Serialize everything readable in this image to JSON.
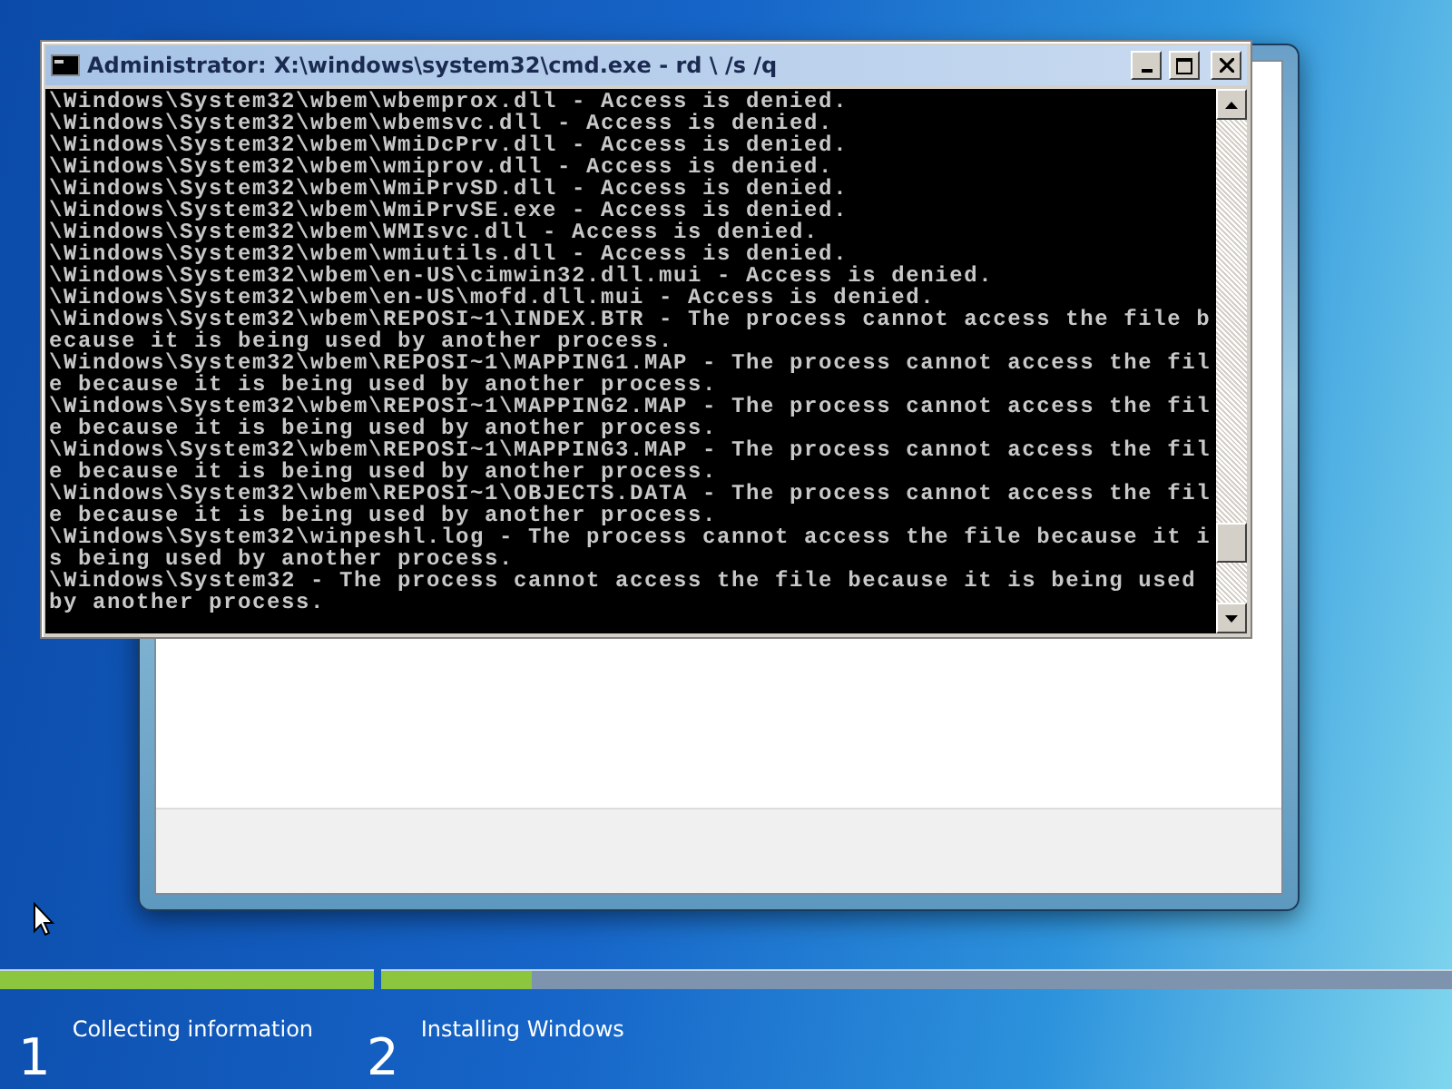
{
  "console_window": {
    "title": "Administrator: X:\\windows\\system32\\cmd.exe - rd \\ /s /q",
    "lines": [
      "\\Windows\\System32\\wbem\\wbemprox.dll - Access is denied.",
      "\\Windows\\System32\\wbem\\wbemsvc.dll - Access is denied.",
      "\\Windows\\System32\\wbem\\WmiDcPrv.dll - Access is denied.",
      "\\Windows\\System32\\wbem\\wmiprov.dll - Access is denied.",
      "\\Windows\\System32\\wbem\\WmiPrvSD.dll - Access is denied.",
      "\\Windows\\System32\\wbem\\WmiPrvSE.exe - Access is denied.",
      "\\Windows\\System32\\wbem\\WMIsvc.dll - Access is denied.",
      "\\Windows\\System32\\wbem\\wmiutils.dll - Access is denied.",
      "\\Windows\\System32\\wbem\\en-US\\cimwin32.dll.mui - Access is denied.",
      "\\Windows\\System32\\wbem\\en-US\\mofd.dll.mui - Access is denied.",
      "\\Windows\\System32\\wbem\\REPOSI~1\\INDEX.BTR - The process cannot access the file b",
      "ecause it is being used by another process.",
      "\\Windows\\System32\\wbem\\REPOSI~1\\MAPPING1.MAP - The process cannot access the fil",
      "e because it is being used by another process.",
      "\\Windows\\System32\\wbem\\REPOSI~1\\MAPPING2.MAP - The process cannot access the fil",
      "e because it is being used by another process.",
      "\\Windows\\System32\\wbem\\REPOSI~1\\MAPPING3.MAP - The process cannot access the fil",
      "e because it is being used by another process.",
      "\\Windows\\System32\\wbem\\REPOSI~1\\OBJECTS.DATA - The process cannot access the fil",
      "e because it is being used by another process.",
      "\\Windows\\System32\\winpeshl.log - The process cannot access the file because it i",
      "s being used by another process.",
      "\\Windows\\System32 - The process cannot access the file because it is being used",
      "by another process."
    ]
  },
  "steps": [
    {
      "number": "1",
      "label": "Collecting information",
      "level": 1
    },
    {
      "number": "2",
      "label": "Installing Windows",
      "level": 0.14
    }
  ]
}
